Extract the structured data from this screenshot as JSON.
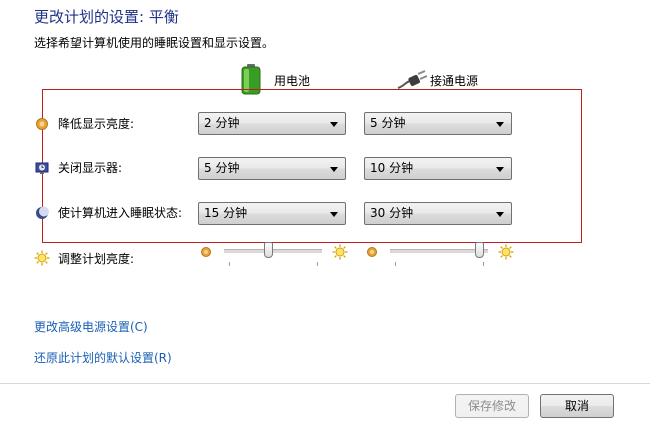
{
  "page": {
    "title": "更改计划的设置: 平衡",
    "subtitle": "选择希望计算机使用的睡眠设置和显示设置。"
  },
  "columns": {
    "battery": {
      "label": "用电池",
      "icon": "battery-icon"
    },
    "ac": {
      "label": "接通电源",
      "icon": "power-plug-icon"
    }
  },
  "rows": [
    {
      "label": "降低显示亮度:",
      "icon": "dim-display-icon",
      "battery": "2 分钟",
      "ac": "5 分钟"
    },
    {
      "label": "关闭显示器:",
      "icon": "display-off-icon",
      "battery": "5 分钟",
      "ac": "10 分钟"
    },
    {
      "label": "使计算机进入睡眠状态:",
      "icon": "sleep-icon",
      "battery": "15 分钟",
      "ac": "30 分钟"
    }
  ],
  "brightness": {
    "label": "调整计划亮度:",
    "battery_level": 0.45,
    "ac_level": 0.95
  },
  "links": {
    "advanced": "更改高级电源设置(C)",
    "restore": "还原此计划的默认设置(R)"
  },
  "buttons": {
    "save": "保存修改",
    "cancel": "取消"
  },
  "colors": {
    "title": "#1e3287",
    "link": "#1a5fb4",
    "highlight": "#c21d1d"
  }
}
